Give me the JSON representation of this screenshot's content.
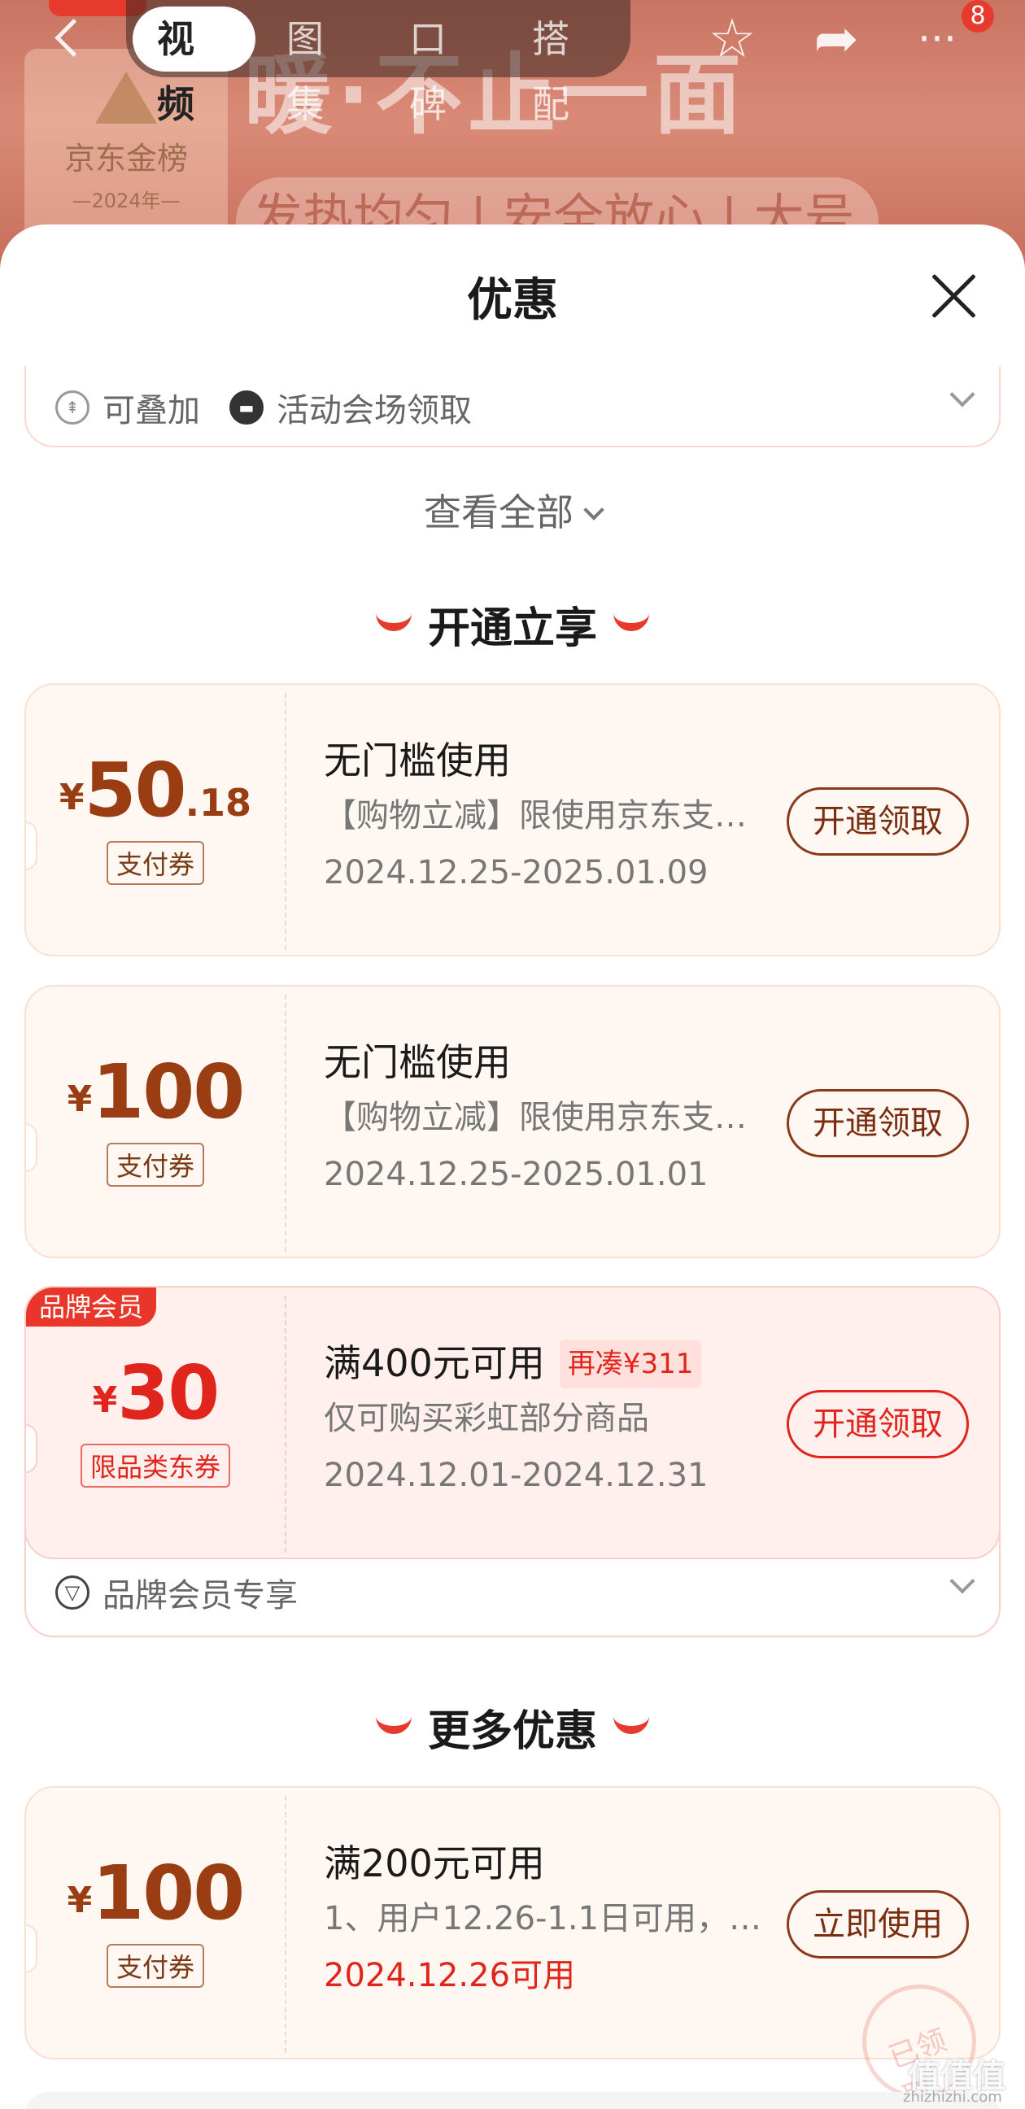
{
  "nav": {
    "tabs": [
      "视频",
      "图集",
      "口碑",
      "搭配"
    ],
    "active_tab": "视频",
    "badge_count": "8",
    "icons": [
      "back-icon",
      "star-icon",
      "share-icon",
      "more-icon"
    ]
  },
  "banner": {
    "headline": "暖·不止一面",
    "subtitle": "发热均匀 | 安全放心 | 大号",
    "mark_title": "京东金榜",
    "mark_year": "—2024年—"
  },
  "sheet": {
    "title": "优惠",
    "prev_tags": [
      "可叠加",
      "活动会场领取"
    ],
    "view_all": "查看全部"
  },
  "sections": [
    {
      "title": "开通立享"
    },
    {
      "title": "更多优惠"
    }
  ],
  "coupons": [
    {
      "symbol": "¥",
      "amount": "50",
      "decimal": ".18",
      "label": "支付券",
      "title": "无门槛使用",
      "desc": "【购物立减】限使用京东支…",
      "date": "2024.12.25-2025.01.09",
      "button": "开通领取"
    },
    {
      "symbol": "¥",
      "amount": "100",
      "decimal": "",
      "label": "支付券",
      "title": "无门槛使用",
      "desc": "【购物立减】限使用京东支…",
      "date": "2024.12.25-2025.01.01",
      "button": "开通领取"
    },
    {
      "badge": "品牌会员",
      "symbol": "¥",
      "amount": "30",
      "decimal": "",
      "label": "限品类东券",
      "title": "满400元可用",
      "extra": "再凑¥311",
      "desc": "仅可购买彩虹部分商品",
      "date": "2024.12.01-2024.12.31",
      "button": "开通领取",
      "footer": "品牌会员专享"
    },
    {
      "symbol": "¥",
      "amount": "100",
      "decimal": "",
      "label": "支付券",
      "title": "满200元可用",
      "desc": "1、用户12.26-1.1日可用，…",
      "date": "2024.12.26可用",
      "button": "立即使用"
    }
  ],
  "stamp_text": "已领取",
  "watermark": "值值值",
  "watermark_url": "zhizhizhi.com",
  "colors": {
    "accent_red": "#e0261c",
    "coupon_brown": "#9a3d12",
    "coupon_bg": "#fff7f1"
  }
}
